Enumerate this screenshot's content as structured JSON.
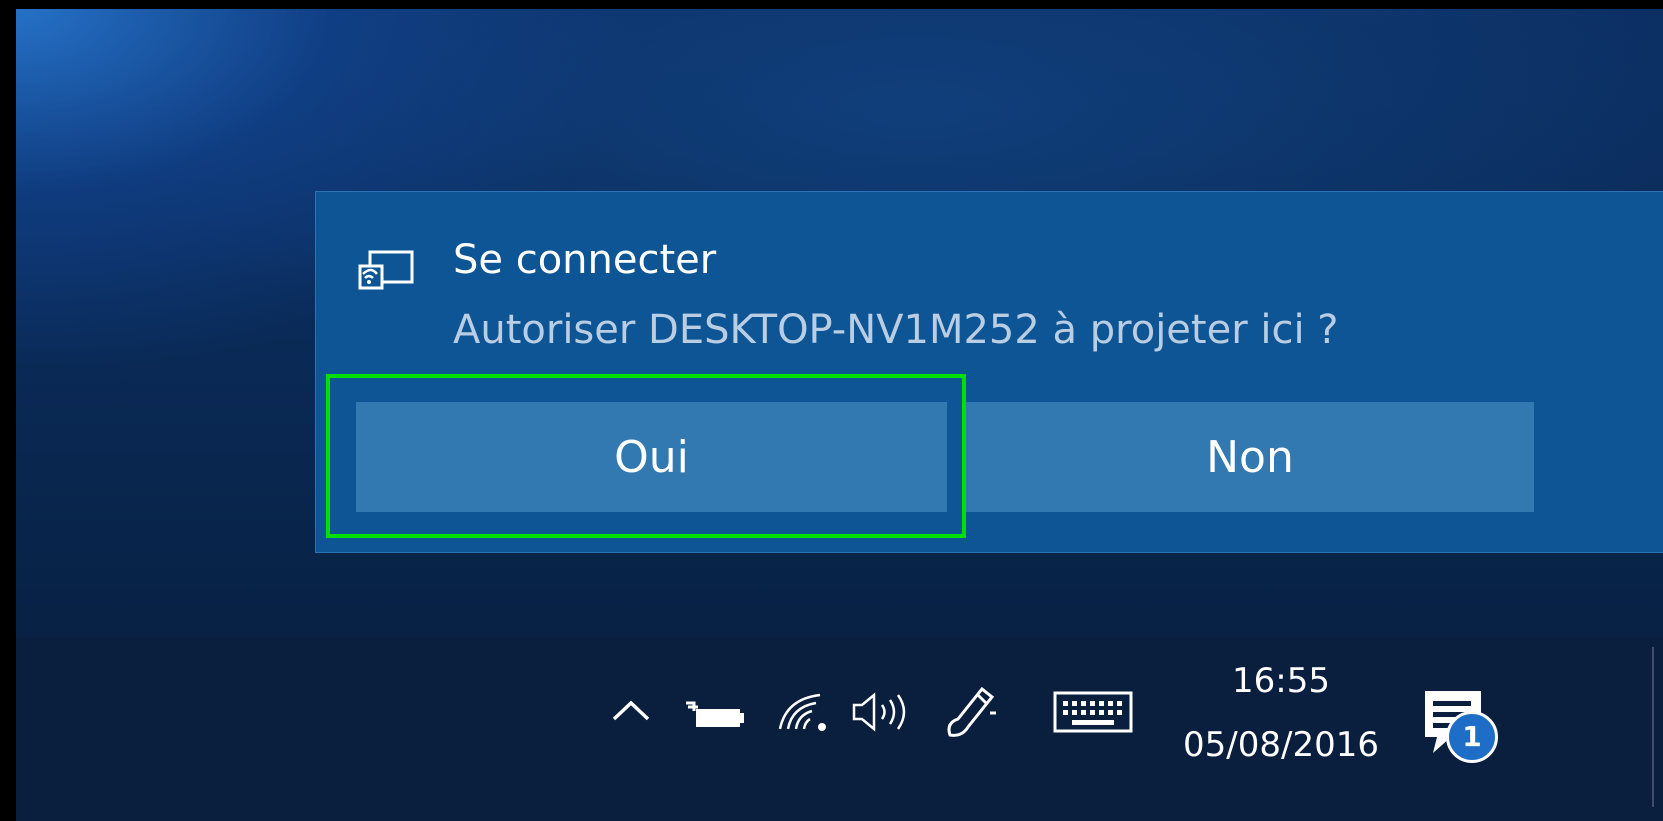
{
  "toast": {
    "icon": "project-to-pc-icon",
    "title": "Se connecter",
    "message": "Autoriser DESKTOP-NV1M252 à projeter ici ?",
    "buttons": {
      "yes_label": "Oui",
      "no_label": "Non"
    },
    "focused_button": "yes"
  },
  "taskbar": {
    "tray_icons": [
      "chevron-up-icon",
      "battery-icon",
      "wifi-icon",
      "volume-icon",
      "pen-icon",
      "touch-keyboard-icon"
    ],
    "clock": {
      "time": "16:55",
      "date": "05/08/2016"
    },
    "notification_center": {
      "icon": "action-center-icon",
      "badge_count": "1"
    }
  },
  "colors": {
    "toast_background": "#0e5596",
    "button_background": "#3278b1",
    "focus_ring": "#00e000",
    "taskbar_background": "#0a1f3e",
    "message_text": "#b9cde3"
  }
}
